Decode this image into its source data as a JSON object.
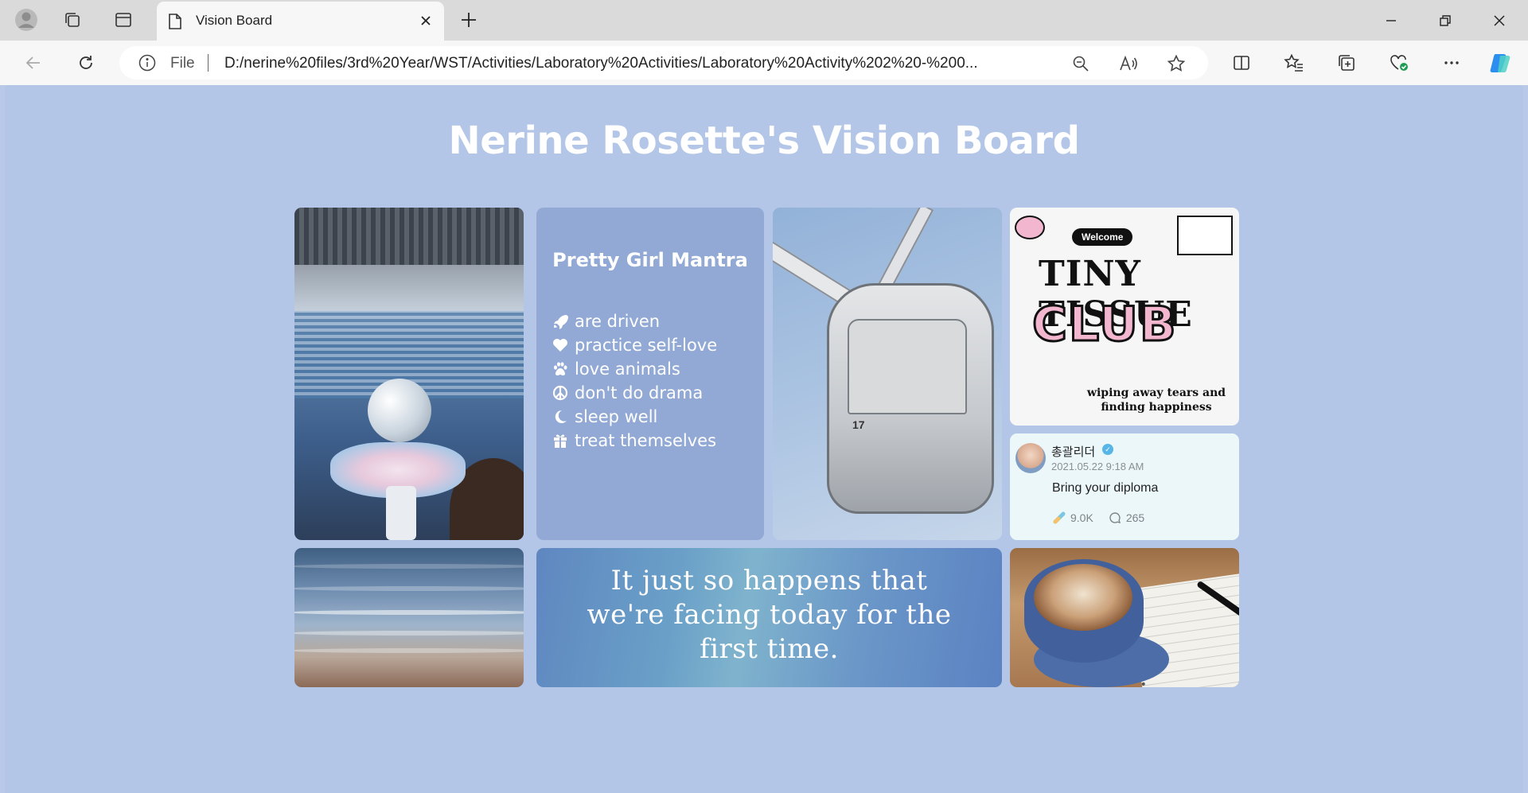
{
  "browser": {
    "tab_title": "Vision Board",
    "address": {
      "scheme_label": "File",
      "url": "D:/nerine%20files/3rd%20Year/WST/Activities/Laboratory%20Activities/Laboratory%20Activity%202%20-%200..."
    }
  },
  "page": {
    "title": "Nerine Rosette's Vision Board"
  },
  "mantra": {
    "heading": "Pretty Girl Mantra",
    "items": [
      {
        "icon": "rocket-icon",
        "text": "are driven"
      },
      {
        "icon": "heart-icon",
        "text": "practice self-love"
      },
      {
        "icon": "paw-icon",
        "text": "love animals"
      },
      {
        "icon": "peace-icon",
        "text": "don't do drama"
      },
      {
        "icon": "moon-icon",
        "text": "sleep well"
      },
      {
        "icon": "gift-icon",
        "text": "treat themselves"
      }
    ]
  },
  "tissue_club": {
    "welcome": "Welcome",
    "title": "TINY TISSUE",
    "club": "CLUB",
    "subtitle": "wiping away tears and finding happiness"
  },
  "tweet": {
    "name": "총괄리더",
    "date": "2021.05.22 9:18 AM",
    "text": "Bring your diploma",
    "likes": "9.0K",
    "comments": "265"
  },
  "quote": {
    "text": "It just so happens that we're facing today for the first time."
  },
  "ferris": {
    "cabin_number": "17"
  }
}
